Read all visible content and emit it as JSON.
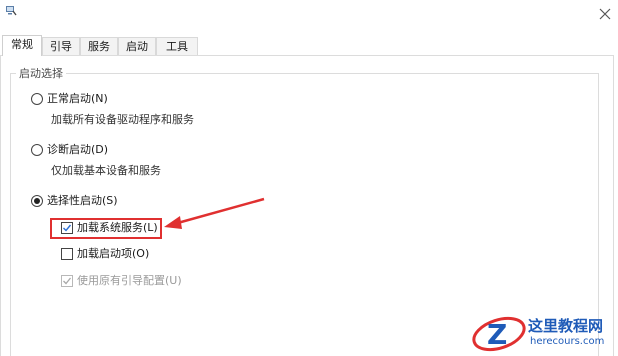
{
  "window": {
    "app_icon": "msconfig-icon",
    "close_icon": "close-icon"
  },
  "tabs": [
    {
      "label": "常规",
      "active": true
    },
    {
      "label": "引导",
      "active": false
    },
    {
      "label": "服务",
      "active": false
    },
    {
      "label": "启动",
      "active": false
    },
    {
      "label": "工具",
      "active": false
    }
  ],
  "startup_selection": {
    "legend": "启动选择",
    "options": [
      {
        "label": "正常启动(N)",
        "description": "加载所有设备驱动程序和服务",
        "selected": false
      },
      {
        "label": "诊断启动(D)",
        "description": "仅加载基本设备和服务",
        "selected": false
      },
      {
        "label": "选择性启动(S)",
        "selected": true
      }
    ],
    "selective_options": [
      {
        "label": "加载系统服务(L)",
        "checked": true,
        "enabled": true,
        "highlighted": true
      },
      {
        "label": "加载启动项(O)",
        "checked": false,
        "enabled": true
      },
      {
        "label": "使用原有引导配置(U)",
        "checked": true,
        "enabled": false
      }
    ]
  },
  "annotation": {
    "highlight_color": "#e03030",
    "arrow_color": "#e03030"
  },
  "watermark": {
    "title": "这里教程网",
    "subtitle": "herecours.com",
    "color": "#1f5bb8"
  }
}
